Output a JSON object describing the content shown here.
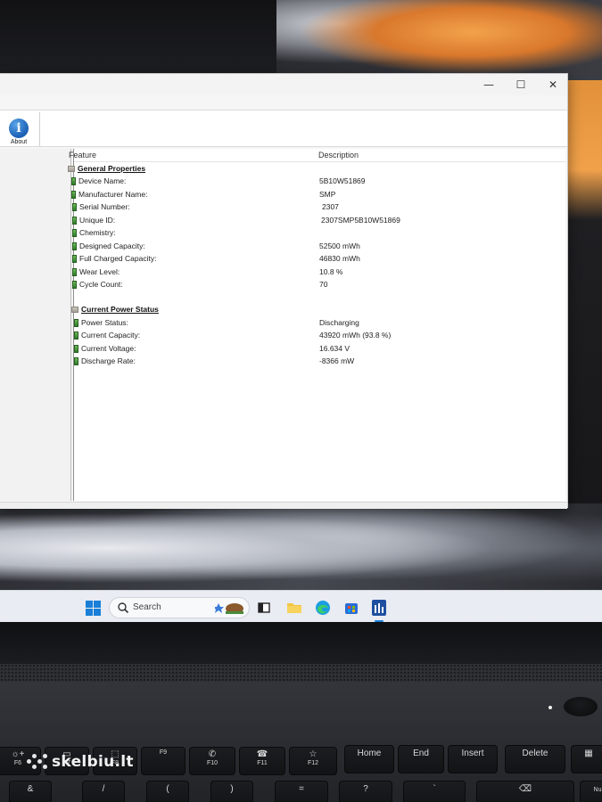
{
  "window": {
    "controls": {
      "minimize": "—",
      "maximize": "☐",
      "close": "✕"
    },
    "toolbar": {
      "about_label": "About",
      "about_icon": "info-icon"
    },
    "columns": {
      "feature": "Feature",
      "description": "Description"
    },
    "sections": [
      {
        "title": "General Properties",
        "rows": [
          {
            "feature": "Device Name:",
            "value": "5B10W51869"
          },
          {
            "feature": "Manufacturer Name:",
            "value": "SMP"
          },
          {
            "feature": "Serial Number:",
            "value": "2307"
          },
          {
            "feature": "Unique ID:",
            "value": "2307SMP5B10W51869"
          },
          {
            "feature": "Chemistry:",
            "value": ""
          },
          {
            "feature": "Designed Capacity:",
            "value": "52500 mWh"
          },
          {
            "feature": "Full Charged Capacity:",
            "value": "46830 mWh"
          },
          {
            "feature": "Wear Level:",
            "value": "10.8 %"
          },
          {
            "feature": "Cycle Count:",
            "value": "70"
          }
        ]
      },
      {
        "title": "Current Power Status",
        "rows": [
          {
            "feature": "Power Status:",
            "value": "Discharging"
          },
          {
            "feature": "Current Capacity:",
            "value": "43920 mWh (93.8 %)"
          },
          {
            "feature": "Current Voltage:",
            "value": "16.634 V"
          },
          {
            "feature": "Discharge Rate:",
            "value": "-8366 mW"
          }
        ]
      }
    ]
  },
  "taskbar": {
    "search_placeholder": "Search",
    "icons": [
      "windows-start-icon",
      "search-icon",
      "task-view-icon",
      "file-explorer-icon",
      "edge-icon",
      "store-icon",
      "battery-app-icon"
    ]
  },
  "keyboard": {
    "keys": [
      {
        "sym": "☼+",
        "label": "F6"
      },
      {
        "sym": "▭",
        "label": "F7"
      },
      {
        "sym": "⬚",
        "label": "F8"
      },
      {
        "sym": "",
        "label": "F9"
      },
      {
        "sym": "✆",
        "label": "F10"
      },
      {
        "sym": "☎",
        "label": "F11"
      },
      {
        "sym": "☆",
        "label": "F12"
      },
      {
        "sym": "",
        "label": "Home"
      },
      {
        "sym": "",
        "label": "End"
      },
      {
        "sym": "",
        "label": "Insert"
      },
      {
        "sym": "",
        "label": "Delete"
      }
    ],
    "number_row": [
      "&",
      "/",
      "(",
      ")",
      "=",
      "?",
      "`",
      "⌫",
      "Nu"
    ]
  },
  "watermark": "skelbiu.lt"
}
